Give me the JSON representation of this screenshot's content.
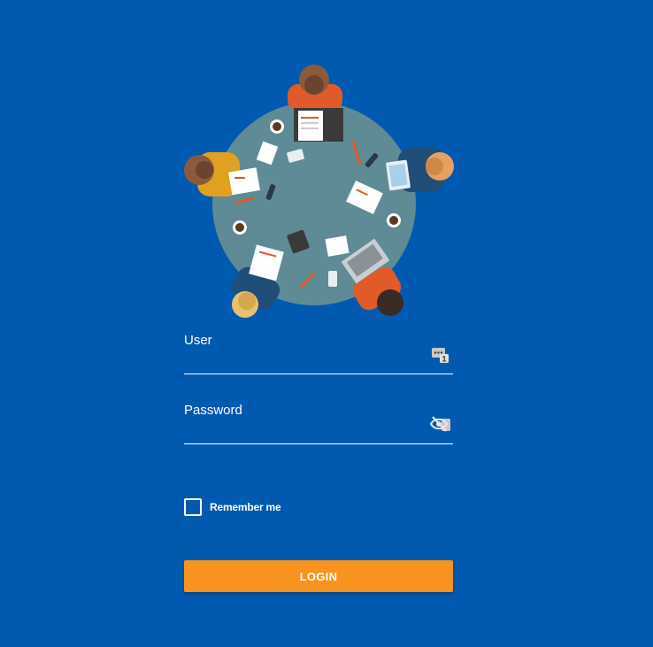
{
  "illustration": {
    "icon": "meeting-table-illustration"
  },
  "form": {
    "user": {
      "label": "User",
      "value": "",
      "icon": "badge-number-icon"
    },
    "password": {
      "label": "Password",
      "value": "",
      "icon": "eye-off-icon"
    },
    "remember": {
      "label": "Remember me",
      "checked": false
    },
    "login_label": "LOGIN"
  },
  "colors": {
    "background": "#005AB0",
    "button": "#F7931E",
    "text": "#FFFFFF"
  }
}
